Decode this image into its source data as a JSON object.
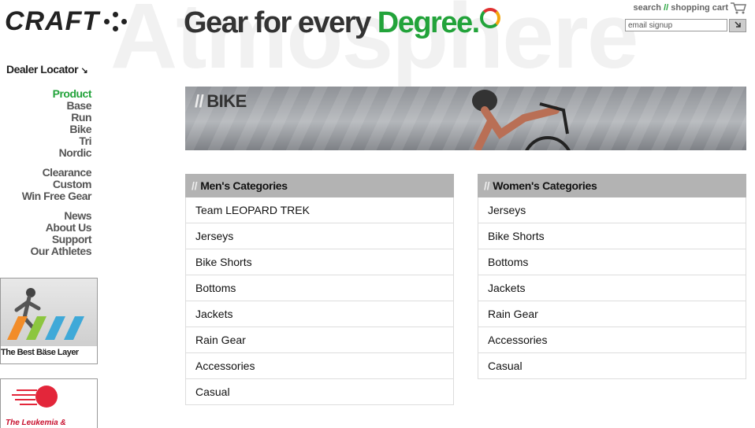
{
  "header": {
    "watermark": "Atmosphere",
    "logo_text": "CRAFT",
    "tagline_main": "Gear for every ",
    "tagline_accent": "Degree.",
    "top_links": {
      "search": "search",
      "separator": "//",
      "cart": "shopping cart"
    },
    "email_placeholder": "email signup",
    "email_go_icon": "arrow-icon"
  },
  "sidebar": {
    "dealer_locator": "Dealer Locator",
    "dealer_icon": "↘",
    "groups": [
      [
        "Product",
        "Base",
        "Run",
        "Bike",
        "Tri",
        "Nordic"
      ],
      [
        "Clearance",
        "Custom",
        "Win Free Gear"
      ],
      [
        "News",
        "About Us",
        "Support",
        "Our Athletes"
      ]
    ],
    "active_item": "Product",
    "promo_base_layer": "The Best Bäse Layer",
    "promo_leukemia": "The Leukemia &"
  },
  "banner": {
    "slash": "//",
    "title": "BIKE"
  },
  "categories": {
    "men": {
      "slash": "//",
      "title": "Men's Categories",
      "items": [
        "Team LEOPARD TREK",
        "Jerseys",
        "Bike Shorts",
        "Bottoms",
        "Jackets",
        "Rain Gear",
        "Accessories",
        "Casual"
      ]
    },
    "women": {
      "slash": "//",
      "title": "Women's Categories",
      "items": [
        "Jerseys",
        "Bike Shorts",
        "Bottoms",
        "Jackets",
        "Rain Gear",
        "Accessories",
        "Casual"
      ]
    }
  },
  "colors": {
    "accent_green": "#22a33a",
    "header_gray": "#b3b3b3"
  }
}
